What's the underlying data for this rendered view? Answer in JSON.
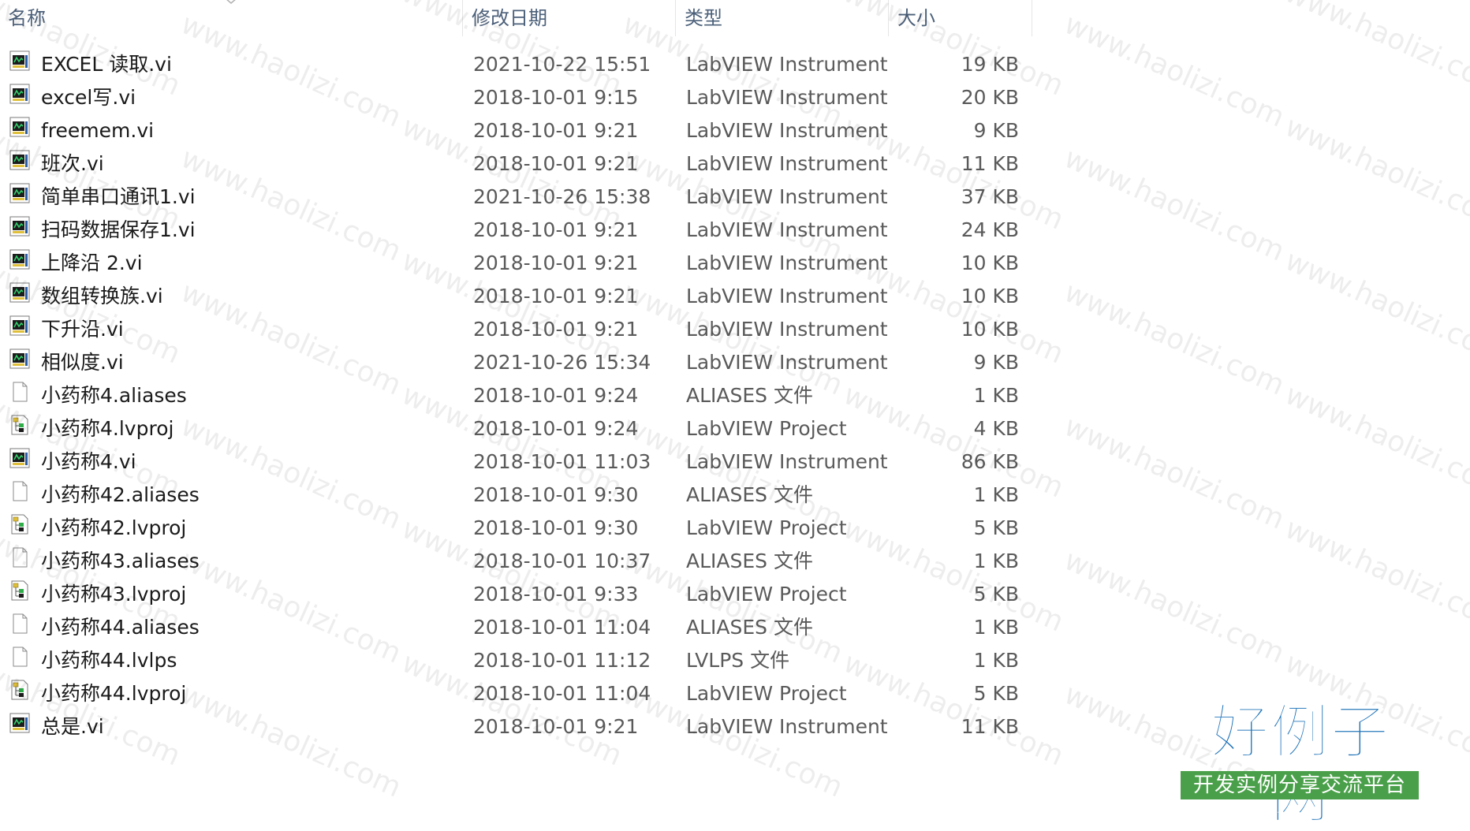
{
  "columns": {
    "name": "名称",
    "date": "修改日期",
    "type": "类型",
    "size": "大小"
  },
  "files": [
    {
      "name": "EXCEL 读取.vi",
      "date": "2021-10-22 15:51",
      "type": "LabVIEW Instrument",
      "size": "19 KB",
      "icon": "labview-vi-icon"
    },
    {
      "name": "excel写.vi",
      "date": "2018-10-01 9:15",
      "type": "LabVIEW Instrument",
      "size": "20 KB",
      "icon": "labview-vi-icon"
    },
    {
      "name": "freemem.vi",
      "date": "2018-10-01 9:21",
      "type": "LabVIEW Instrument",
      "size": "9 KB",
      "icon": "labview-vi-icon"
    },
    {
      "name": "班次.vi",
      "date": "2018-10-01 9:21",
      "type": "LabVIEW Instrument",
      "size": "11 KB",
      "icon": "labview-vi-icon"
    },
    {
      "name": "简单串口通讯1.vi",
      "date": "2021-10-26 15:38",
      "type": "LabVIEW Instrument",
      "size": "37 KB",
      "icon": "labview-vi-icon"
    },
    {
      "name": "扫码数据保存1.vi",
      "date": "2018-10-01 9:21",
      "type": "LabVIEW Instrument",
      "size": "24 KB",
      "icon": "labview-vi-icon"
    },
    {
      "name": "上降沿 2.vi",
      "date": "2018-10-01 9:21",
      "type": "LabVIEW Instrument",
      "size": "10 KB",
      "icon": "labview-vi-icon"
    },
    {
      "name": "数组转换族.vi",
      "date": "2018-10-01 9:21",
      "type": "LabVIEW Instrument",
      "size": "10 KB",
      "icon": "labview-vi-icon"
    },
    {
      "name": "下升沿.vi",
      "date": "2018-10-01 9:21",
      "type": "LabVIEW Instrument",
      "size": "10 KB",
      "icon": "labview-vi-icon"
    },
    {
      "name": "相似度.vi",
      "date": "2021-10-26 15:34",
      "type": "LabVIEW Instrument",
      "size": "9 KB",
      "icon": "labview-vi-icon"
    },
    {
      "name": "小药称4.aliases",
      "date": "2018-10-01 9:24",
      "type": "ALIASES 文件",
      "size": "1 KB",
      "icon": "blank-file-icon"
    },
    {
      "name": "小药称4.lvproj",
      "date": "2018-10-01 9:24",
      "type": "LabVIEW Project",
      "size": "4 KB",
      "icon": "labview-project-icon"
    },
    {
      "name": "小药称4.vi",
      "date": "2018-10-01 11:03",
      "type": "LabVIEW Instrument",
      "size": "86 KB",
      "icon": "labview-vi-icon"
    },
    {
      "name": "小药称42.aliases",
      "date": "2018-10-01 9:30",
      "type": "ALIASES 文件",
      "size": "1 KB",
      "icon": "blank-file-icon"
    },
    {
      "name": "小药称42.lvproj",
      "date": "2018-10-01 9:30",
      "type": "LabVIEW Project",
      "size": "5 KB",
      "icon": "labview-project-icon"
    },
    {
      "name": "小药称43.aliases",
      "date": "2018-10-01 10:37",
      "type": "ALIASES 文件",
      "size": "1 KB",
      "icon": "blank-file-icon"
    },
    {
      "name": "小药称43.lvproj",
      "date": "2018-10-01 9:33",
      "type": "LabVIEW Project",
      "size": "5 KB",
      "icon": "labview-project-icon"
    },
    {
      "name": "小药称44.aliases",
      "date": "2018-10-01 11:04",
      "type": "ALIASES 文件",
      "size": "1 KB",
      "icon": "blank-file-icon"
    },
    {
      "name": "小药称44.lvlps",
      "date": "2018-10-01 11:12",
      "type": "LVLPS 文件",
      "size": "1 KB",
      "icon": "blank-file-icon"
    },
    {
      "name": "小药称44.lvproj",
      "date": "2018-10-01 11:04",
      "type": "LabVIEW Project",
      "size": "5 KB",
      "icon": "labview-project-icon"
    },
    {
      "name": "总是.vi",
      "date": "2018-10-01 9:21",
      "type": "LabVIEW Instrument",
      "size": "11 KB",
      "icon": "labview-vi-icon"
    }
  ],
  "watermark": "www.haolizi.com",
  "logo": {
    "title": "好例子网",
    "subtitle": "开发实例分享交流平台"
  },
  "colors": {
    "header_text": "#4c607a",
    "logo_blue": "#1f73b8",
    "logo_green": "#4aa04a"
  }
}
